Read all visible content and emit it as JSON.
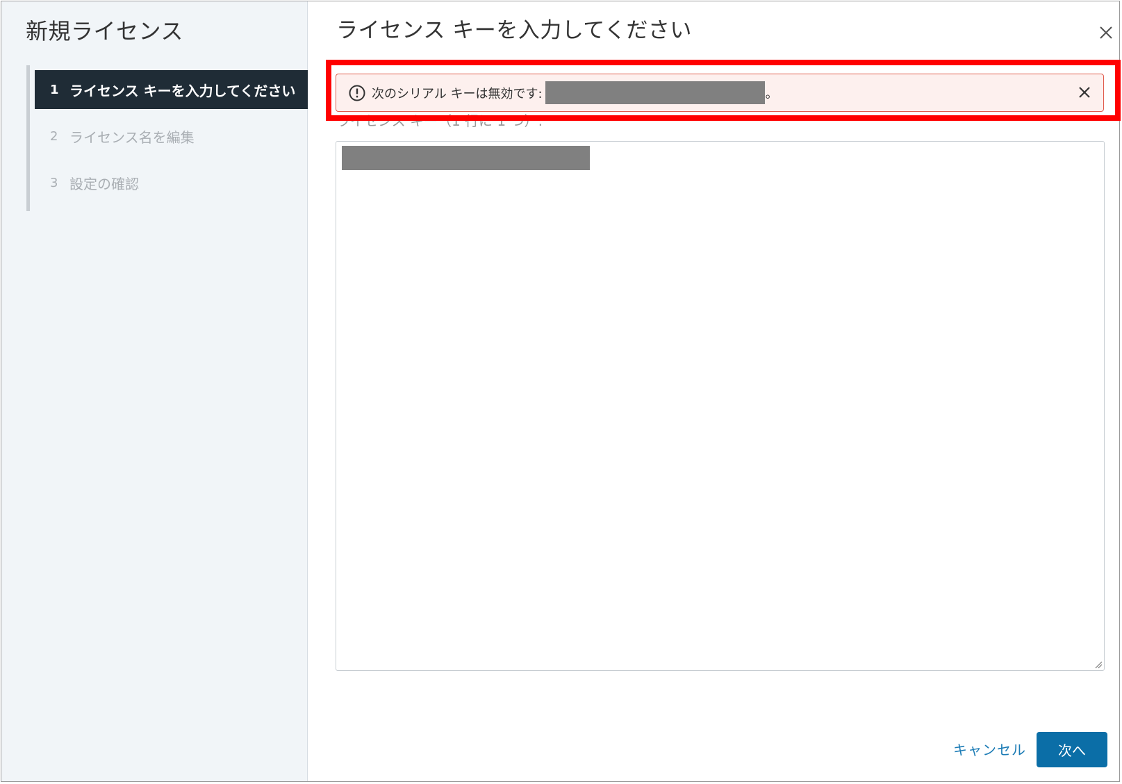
{
  "sidebar": {
    "title": "新規ライセンス",
    "steps": [
      {
        "num": "1",
        "label": "ライセンス キーを入力してください",
        "state": "active"
      },
      {
        "num": "2",
        "label": "ライセンス名を編集",
        "state": "inactive"
      },
      {
        "num": "3",
        "label": "設定の確認",
        "state": "inactive"
      }
    ]
  },
  "main": {
    "title": "ライセンス キーを入力してください",
    "alert": {
      "message": "次のシリアル キーは無効です:",
      "suffix": "。",
      "icon": "alert-circle-icon"
    },
    "field": {
      "label": "ライセンス キー（1 行に 1 つ）:"
    }
  },
  "footer": {
    "cancel_label": "キャンセル",
    "next_label": "次へ"
  },
  "colors": {
    "active_step_bg": "#1f2c36",
    "primary_button": "#0b6ea7",
    "link": "#1b7bb5",
    "alert_border": "#e05b4c",
    "alert_bg": "#fdf0ee",
    "highlight": "#ff0000"
  }
}
